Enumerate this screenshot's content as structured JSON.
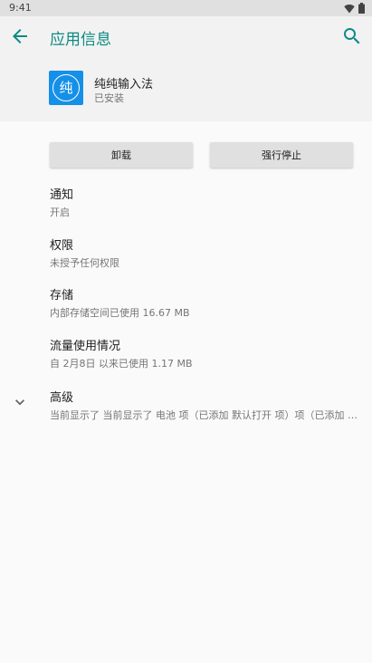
{
  "status_bar": {
    "time": "9:41"
  },
  "app_bar": {
    "title": "应用信息"
  },
  "app": {
    "icon_glyph": "纯",
    "name": "纯纯输入法",
    "status": "已安装"
  },
  "buttons": {
    "uninstall": "卸载",
    "force_stop": "强行停止"
  },
  "items": [
    {
      "title": "通知",
      "subtitle": "开启"
    },
    {
      "title": "权限",
      "subtitle": "未授予任何权限"
    },
    {
      "title": "存储",
      "subtitle": "内部存储空间已使用 16.67 MB"
    },
    {
      "title": "流量使用情况",
      "subtitle": "自 2月8日 以来已使用 1.17 MB"
    },
    {
      "title": "高级",
      "subtitle": "当前显示了 当前显示了 电池 项（已添加 默认打开 项）项（已添加 高级…"
    }
  ],
  "colors": {
    "accent": "#0b8a83",
    "app_icon_bg": "#1590e8",
    "button_bg": "#e0e0e0"
  },
  "icons": [
    "wifi-icon",
    "battery-icon",
    "back-arrow-icon",
    "search-icon",
    "chevron-down-icon"
  ]
}
